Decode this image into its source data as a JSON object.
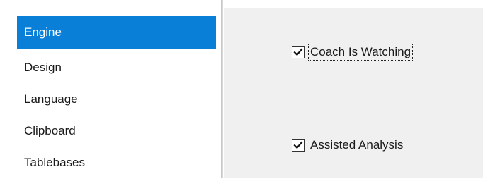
{
  "sidebar": {
    "items": [
      {
        "label": "Engine",
        "selected": true
      },
      {
        "label": "Design",
        "selected": false
      },
      {
        "label": "Language",
        "selected": false
      },
      {
        "label": "Clipboard",
        "selected": false
      },
      {
        "label": "Tablebases",
        "selected": false
      }
    ]
  },
  "options": {
    "coach_is_watching": {
      "label": "Coach Is Watching",
      "checked": true,
      "focused": true
    },
    "assisted_analysis": {
      "label": "Assisted Analysis",
      "checked": true,
      "focused": false
    }
  },
  "colors": {
    "selection": "#0a7fd8",
    "panel_background": "#f0f0f0"
  }
}
